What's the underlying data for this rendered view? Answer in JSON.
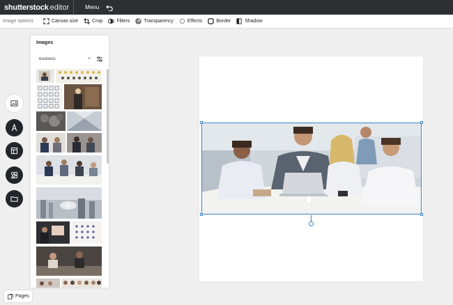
{
  "topbar": {
    "brand_bold": "shutterstock",
    "brand_light": "editor",
    "menu_label": "Menu"
  },
  "options": {
    "title": "Image options",
    "items": [
      {
        "label": "Canvas size",
        "icon": "resize-icon"
      },
      {
        "label": "Crop",
        "icon": "crop-icon"
      },
      {
        "label": "Filters",
        "icon": "filters-icon"
      },
      {
        "label": "Transparency",
        "icon": "transparency-icon"
      },
      {
        "label": "Effects",
        "icon": "effects-icon"
      },
      {
        "label": "Border",
        "icon": "border-icon"
      },
      {
        "label": "Shadow",
        "icon": "shadow-icon"
      }
    ]
  },
  "rail": {
    "items": [
      {
        "name": "images",
        "icon": "image-icon"
      },
      {
        "name": "text",
        "icon": "text-icon"
      },
      {
        "name": "templates",
        "icon": "layout-icon"
      },
      {
        "name": "elements",
        "icon": "elements-icon"
      },
      {
        "name": "uploads",
        "icon": "folder-icon"
      }
    ]
  },
  "panel": {
    "title": "Images",
    "search_value": "business",
    "clear_glyph": "×"
  },
  "pages": {
    "label": "Pages"
  }
}
